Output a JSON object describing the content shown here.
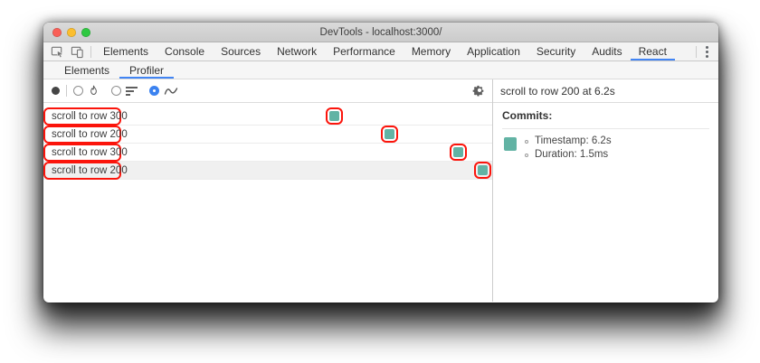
{
  "window": {
    "title": "DevTools - localhost:3000/"
  },
  "devtools": {
    "tabs": [
      "Elements",
      "Console",
      "Sources",
      "Network",
      "Performance",
      "Memory",
      "Application",
      "Security",
      "Audits",
      "React"
    ],
    "active_tab": "React"
  },
  "react_devtools": {
    "tabs": [
      "Elements",
      "Profiler"
    ],
    "active_tab": "Profiler"
  },
  "profiler": {
    "toolbar": {
      "views": [
        {
          "name": "flamegraph",
          "selected": false
        },
        {
          "name": "ranked",
          "selected": false
        },
        {
          "name": "interactions",
          "selected": true
        }
      ]
    },
    "selected_interaction_header": "scroll to row 200 at 6.2s",
    "rows": [
      {
        "label": "scroll to row 300",
        "marker_box_style": "left:312px",
        "selected": false
      },
      {
        "label": "scroll to row 200",
        "marker_box_style": "left:373px",
        "selected": false
      },
      {
        "label": "scroll to row 300",
        "marker_box_style": "left:449px",
        "selected": false
      },
      {
        "label": "scroll to row 200",
        "marker_box_style": "left:476px",
        "selected": true
      }
    ]
  },
  "details": {
    "heading": "Commits:",
    "commit": {
      "color": "#62b3a4",
      "properties": [
        "Timestamp: 6.2s",
        "Duration: 1.5ms"
      ]
    }
  },
  "colors": {
    "accent_blue": "#4285f4",
    "annotation_red": "#fb140b",
    "commit_teal": "#62b3a4",
    "selected_row_bg": "#f0f0f0"
  }
}
